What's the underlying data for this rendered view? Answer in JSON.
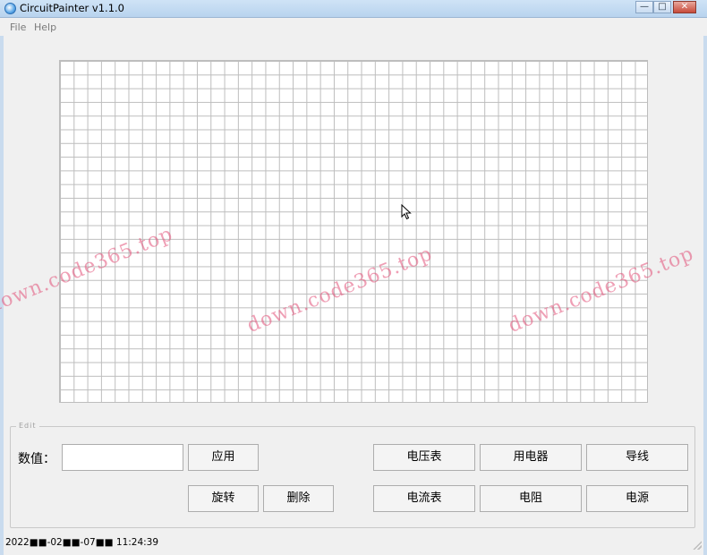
{
  "window": {
    "title": "CircuitPainter v1.1.0",
    "minimize": "—",
    "maximize": "□",
    "close": "✕"
  },
  "menu": {
    "file": "File",
    "help": "Help"
  },
  "watermark": {
    "text": "down.code365.top"
  },
  "edit": {
    "legend": "Edit",
    "value_label": "数值：",
    "value_input": "",
    "apply": "应用",
    "rotate": "旋转",
    "delete": "删除",
    "voltmeter": "电压表",
    "appliance": "用电器",
    "wire": "导线",
    "ammeter": "电流表",
    "resistor": "电阻",
    "power_source": "电源"
  },
  "status": {
    "datetime": "2022■■-02■■-07■■ 11:24:39"
  }
}
